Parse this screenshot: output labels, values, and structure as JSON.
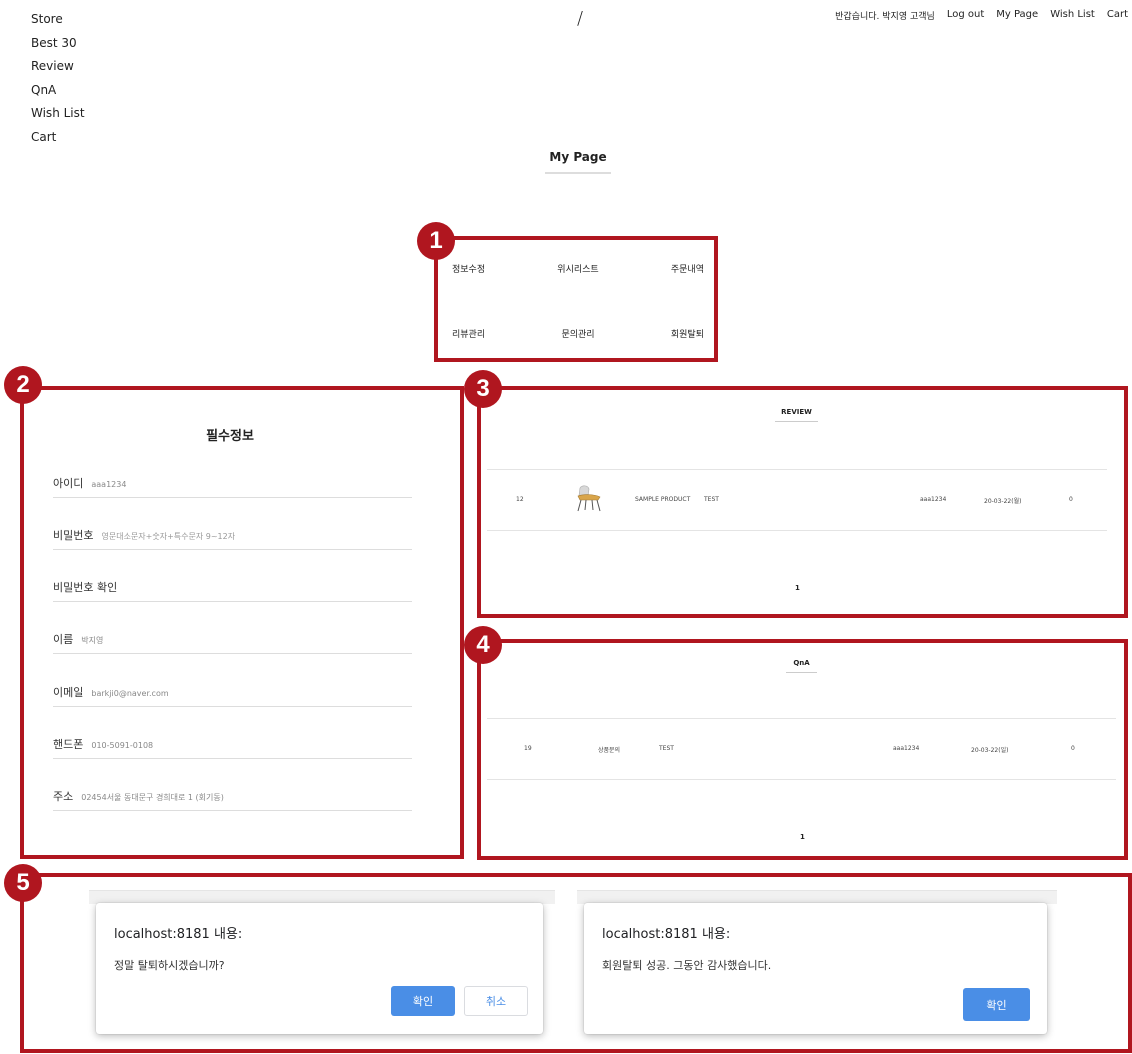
{
  "nav": {
    "items": [
      "Store",
      "Best 30",
      "Review",
      "QnA",
      "Wish List",
      "Cart"
    ]
  },
  "header": {
    "logo_text": "/",
    "greeting": "반갑습니다. 박지영 고객님",
    "links": [
      "Log out",
      "My Page",
      "Wish List",
      "Cart"
    ]
  },
  "page_title": "My Page",
  "annotations": {
    "colors": {
      "box": "#b0161f"
    },
    "labels": [
      "1",
      "2",
      "3",
      "4",
      "5"
    ]
  },
  "mypage_menu": {
    "row1": [
      "정보수정",
      "위시리스트",
      "주문내역"
    ],
    "row2": [
      "리뷰관리",
      "문의관리",
      "회원탈퇴"
    ]
  },
  "required_info": {
    "title": "필수정보",
    "fields": [
      {
        "label": "아이디",
        "value": "aaa1234"
      },
      {
        "label": "비밀번호",
        "value": "영문대소문자+숫자+특수문자 9~12자"
      },
      {
        "label": "비밀번호 확인",
        "value": ""
      },
      {
        "label": "이름",
        "value": "박지영"
      },
      {
        "label": "이메일",
        "value": "barkji0@naver.com"
      },
      {
        "label": "핸드폰",
        "value": "010-5091-0108"
      },
      {
        "label": "주소",
        "value": "02454서울 동대문구 경희대로 1 (회기동)"
      }
    ]
  },
  "review": {
    "title": "REVIEW",
    "row": {
      "no": "12",
      "product": "SAMPLE PRODUCT",
      "subject": "TEST",
      "writer": "aaa1234",
      "date": "20-03-22(월)",
      "hits": "0"
    },
    "page": "1"
  },
  "qna": {
    "title": "QnA",
    "row": {
      "no": "19",
      "category": "상품문의",
      "subject": "TEST",
      "writer": "aaa1234",
      "date": "20-03-22(일)",
      "hits": "0"
    },
    "page": "1"
  },
  "dialog_confirm": {
    "title": "localhost:8181 내용:",
    "message": "정말 탈퇴하시겠습니까?",
    "ok": "확인",
    "cancel": "취소",
    "button_color": "#4a8ee6"
  },
  "dialog_alert": {
    "title": "localhost:8181 내용:",
    "message": "회원탈퇴 성공. 그동안 감사했습니다.",
    "ok": "확인"
  }
}
